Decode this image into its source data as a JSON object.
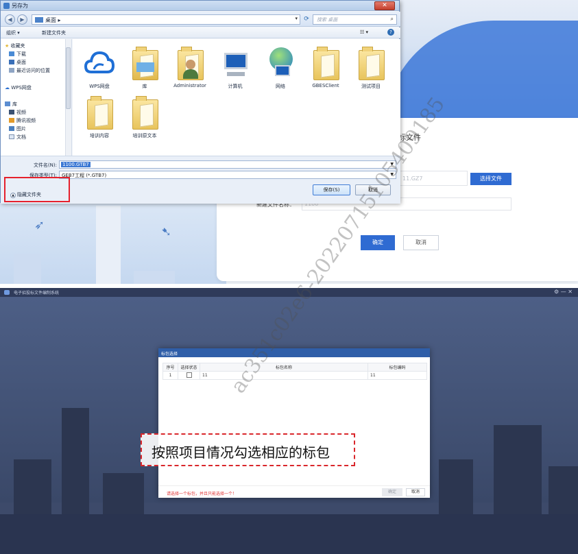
{
  "save_dialog": {
    "title": "另存为",
    "address": "桌面",
    "search_placeholder": "搜索 桌面",
    "toolbar": {
      "organize": "组织 ▾",
      "new_folder": "新建文件夹"
    },
    "nav": {
      "favorites": "收藏夹",
      "downloads": "下载",
      "desktop": "桌面",
      "recent": "最近访问的位置",
      "wps_cloud": "WPS网盘",
      "library": "库",
      "videos": "视频",
      "tencent_video": "腾讯视频",
      "pictures": "图片",
      "documents": "文档"
    },
    "files": [
      {
        "label": "WPS网盘",
        "icon": "cloud-icon"
      },
      {
        "label": "库",
        "icon": "library-folder-icon"
      },
      {
        "label": "Administrator",
        "icon": "user-folder-icon"
      },
      {
        "label": "计算机",
        "icon": "computer-icon"
      },
      {
        "label": "网络",
        "icon": "network-icon"
      },
      {
        "label": "GBESClient",
        "icon": "folder-icon"
      },
      {
        "label": "测试项目",
        "icon": "folder-icon"
      },
      {
        "label": "培训内容",
        "icon": "folder-icon"
      },
      {
        "label": "培训原文本",
        "icon": "folder-icon"
      }
    ],
    "filename_label": "文件名(N):",
    "filename_value": "1100.GTB7",
    "filetype_label": "保存类型(T):",
    "filetype_value": "GEB7工程 (*.GTB7)",
    "hide_folders": "隐藏文件夹",
    "save_button": "保存(S)",
    "cancel_button": "取消"
  },
  "background_panel": {
    "title_fragment": "标文件",
    "file_value": "11.GZ7",
    "choose_file_button": "选择文件",
    "new_file_label": "新建文件名称：",
    "new_file_value": "1100",
    "confirm_button": "确定",
    "cancel_button": "取消"
  },
  "bottom_window": {
    "title": "电子招投标文件编制系统",
    "modal": {
      "title": "标包选择",
      "columns": [
        "序号",
        "选择状态",
        "标包名称",
        "标包编码"
      ],
      "rows": [
        {
          "index": "1",
          "name": "11",
          "code": "11"
        }
      ],
      "warning": "请选择一个标包，并且只能选择一个！",
      "ok_button": "确定",
      "cancel_button": "取消"
    },
    "annotation": "按照项目情况勾选相应的标包"
  },
  "watermark": "ac351c02e6-20220715105409185",
  "colors": {
    "primary_blue": "#2f6bd2",
    "highlight_red": "#e5202c",
    "dark_bg": "#3d4a6a"
  }
}
